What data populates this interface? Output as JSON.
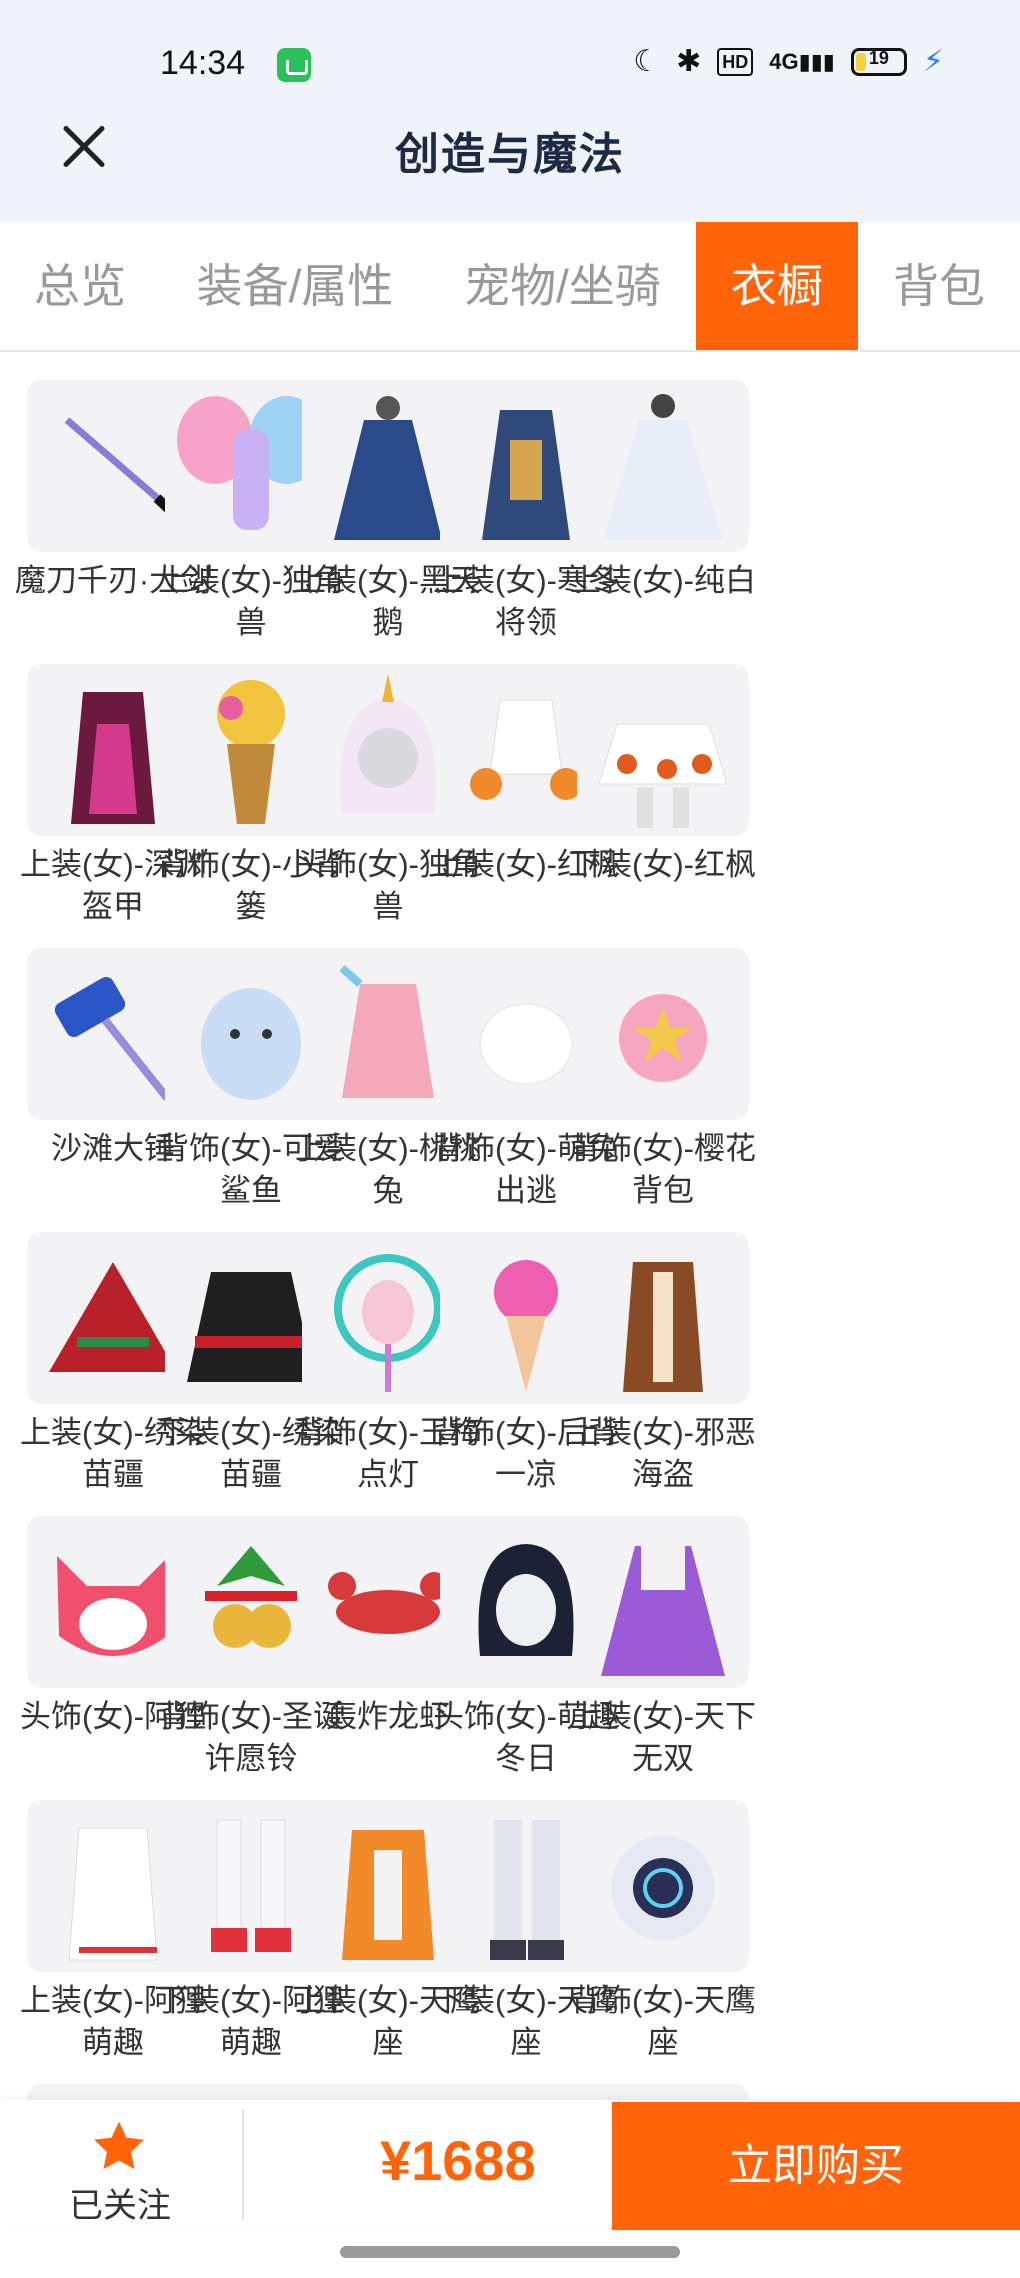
{
  "status": {
    "time": "14:34",
    "network": "4G",
    "battery": "19",
    "hd": "HD"
  },
  "header": {
    "title": "创造与魔法"
  },
  "tabs": [
    {
      "label": "总览"
    },
    {
      "label": "装备/属性"
    },
    {
      "label": "宠物/坐骑"
    },
    {
      "label": "衣橱",
      "active": true
    },
    {
      "label": "背包"
    }
  ],
  "items": [
    {
      "name": "魔刀千刃·大剑",
      "icon": "sword-icon"
    },
    {
      "name": "上装(女)-独角兽",
      "icon": "unicorn-wings-top-icon"
    },
    {
      "name": "上装(女)-黑天鹅",
      "icon": "black-swan-dress-icon"
    },
    {
      "name": "上装(女)-寒冬将领",
      "icon": "winter-general-outfit-icon"
    },
    {
      "name": "上装(女)-纯白",
      "icon": "white-dress-icon"
    },
    {
      "name": "上装(女)-深渊盔甲",
      "icon": "abyss-armor-icon"
    },
    {
      "name": "背饰(女)-小背篓",
      "icon": "flower-basket-icon"
    },
    {
      "name": "头饰(女)-独角兽",
      "icon": "unicorn-hood-icon"
    },
    {
      "name": "上装(女)-红枫",
      "icon": "maple-top-icon"
    },
    {
      "name": "下装(女)-红枫",
      "icon": "maple-skirt-icon"
    },
    {
      "name": "沙滩大锤",
      "icon": "beach-hammer-icon"
    },
    {
      "name": "背饰(女)-可爱鲨鱼",
      "icon": "shark-backpack-icon"
    },
    {
      "name": "上装(女)-桃桃兔",
      "icon": "peach-bunny-top-icon"
    },
    {
      "name": "背饰(女)-萌兔出逃",
      "icon": "white-bunny-backpack-icon"
    },
    {
      "name": "背饰(女)-樱花背包",
      "icon": "sakura-backpack-icon"
    },
    {
      "name": "上装(女)-绣染苗疆",
      "icon": "embroidered-poncho-icon"
    },
    {
      "name": "下装(女)-绣染苗疆",
      "icon": "embroidered-skirt-icon"
    },
    {
      "name": "背饰(女)-玉梅点灯",
      "icon": "lantern-icon"
    },
    {
      "name": "背饰(女)-后背一凉",
      "icon": "ice-cream-icon"
    },
    {
      "name": "上装(女)-邪恶海盗",
      "icon": "pirate-vest-icon"
    },
    {
      "name": "头饰(女)-阿狸",
      "icon": "ali-fox-head-icon"
    },
    {
      "name": "背饰(女)-圣诞许愿铃",
      "icon": "christmas-bell-icon"
    },
    {
      "name": "轰炸龙虾",
      "icon": "lobster-icon"
    },
    {
      "name": "头饰(女)-萌趣冬日",
      "icon": "winter-hair-icon"
    },
    {
      "name": "上装(女)-天下无双",
      "icon": "purple-dress-icon"
    },
    {
      "name": "上装(女)-阿狸萌趣",
      "icon": "white-hoodie-icon"
    },
    {
      "name": "下装(女)-阿狸萌趣",
      "icon": "white-boots-icon"
    },
    {
      "name": "上装(女)-天鹰座",
      "icon": "aquila-jacket-icon"
    },
    {
      "name": "下装(女)-天鹰座",
      "icon": "aquila-pants-icon"
    },
    {
      "name": "背饰(女)-天鹰座",
      "icon": "aquila-backpack-icon"
    }
  ],
  "footer": {
    "follow_label": "已关注",
    "price": "¥1688",
    "buy_label": "立即购买"
  },
  "colors": {
    "accent": "#ff640a",
    "header_bg": "#f0f3f7",
    "tile_bg": "#f3f3f5"
  }
}
